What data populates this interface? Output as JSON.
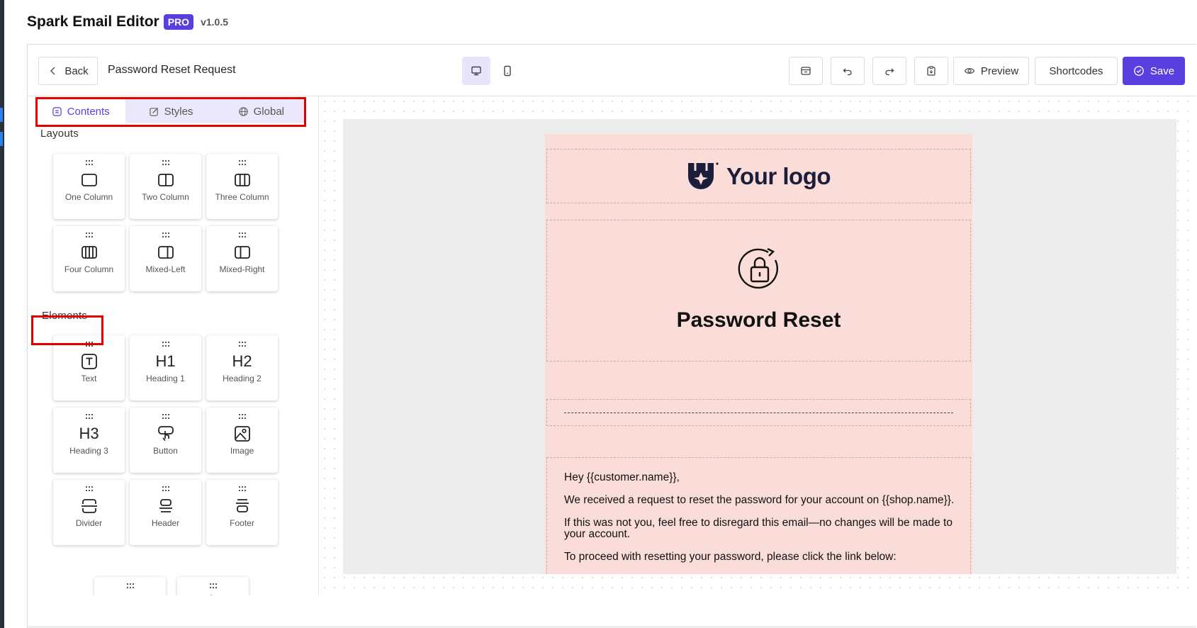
{
  "app": {
    "title": "Spark Email Editor",
    "badge": "PRO",
    "version": "v1.0.5"
  },
  "toolbar": {
    "back_label": "Back",
    "document_name": "Password Reset Request",
    "preview_label": "Preview",
    "shortcodes_label": "Shortcodes",
    "save_label": "Save"
  },
  "sidebar": {
    "tabs": [
      {
        "label": "Contents",
        "icon": "contents-icon",
        "active": true
      },
      {
        "label": "Styles",
        "icon": "brush-icon",
        "active": false
      },
      {
        "label": "Global",
        "icon": "globe-icon",
        "active": false
      }
    ],
    "layouts_title": "Layouts",
    "layouts": [
      {
        "label": "One Column",
        "icon": "one-column-icon"
      },
      {
        "label": "Two Column",
        "icon": "two-column-icon"
      },
      {
        "label": "Three Column",
        "icon": "three-column-icon"
      },
      {
        "label": "Four Column",
        "icon": "four-column-icon"
      },
      {
        "label": "Mixed-Left",
        "icon": "mixed-left-icon"
      },
      {
        "label": "Mixed-Right",
        "icon": "mixed-right-icon"
      }
    ],
    "elements_title": "Elements",
    "elements": [
      {
        "label": "Text",
        "icon": "text-icon"
      },
      {
        "label": "Heading 1",
        "glyph": "H1"
      },
      {
        "label": "Heading 2",
        "glyph": "H2"
      },
      {
        "label": "Heading 3",
        "glyph": "H3"
      },
      {
        "label": "Button",
        "icon": "button-icon"
      },
      {
        "label": "Image",
        "icon": "image-icon"
      },
      {
        "label": "Divider",
        "icon": "divider-icon"
      },
      {
        "label": "Header",
        "icon": "header-icon"
      },
      {
        "label": "Footer",
        "icon": "footer-icon"
      }
    ]
  },
  "email": {
    "logo_text": "Your logo",
    "title": "Password Reset",
    "greeting": "Hey {{customer.name}},",
    "paragraph1": "We received a request to reset the password for your account on {{shop.name}}.",
    "paragraph2": "If this was not you, feel free to disregard this email—no changes will be made to your account.",
    "paragraph3": "To proceed with resetting your password, please click the link below:"
  },
  "colors": {
    "accent": "#5a3fe0",
    "highlight": "#e00000",
    "email_background": "#fadcd8"
  }
}
